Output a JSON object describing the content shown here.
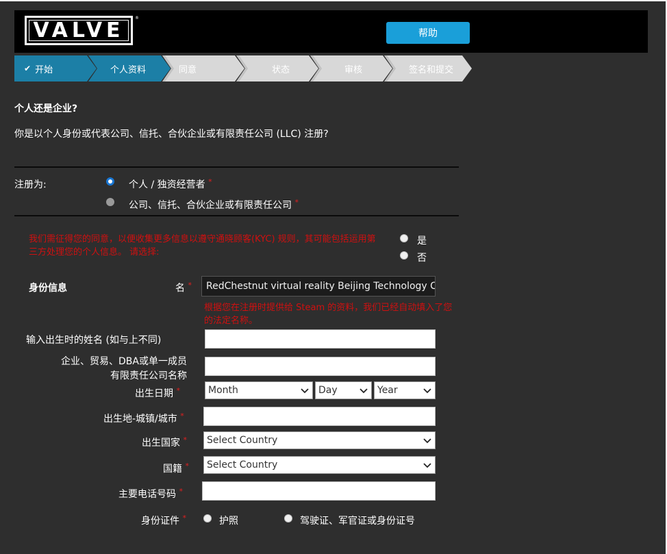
{
  "header": {
    "logo_text": "VALVE",
    "logo_tm": "®",
    "help_label": "帮助",
    "help_color": "#1a9fd9"
  },
  "steps": [
    {
      "label": "开始",
      "state": "done",
      "check": "✔"
    },
    {
      "label": "个人资料",
      "state": "active"
    },
    {
      "label": "同意",
      "state": "pending"
    },
    {
      "label": "状态",
      "state": "pending"
    },
    {
      "label": "审核",
      "state": "pending"
    },
    {
      "label": "签名和提交",
      "state": "pending"
    }
  ],
  "entity": {
    "heading": "个人还是企业?",
    "question": "你是以个人身份或代表公司、信托、合伙企业或有限责任公司 (LLC) 注册?",
    "register_as_label": "注册为:",
    "option_individual": "个人 / 独资经营者",
    "option_company": "公司、信托、合伙企业或有限责任公司",
    "required_mark": "*"
  },
  "kyc": {
    "text": "我们需征得您的同意，以便收集更多信息以遵守通晓顾客(KYC) 规则，其可能包括运用第三方处理您的个人信息。 请选择:",
    "yes": "是",
    "no": "否"
  },
  "identity": {
    "section_label": "身份信息",
    "name_label": "名",
    "name_value": "RedChestnut virtual reality Beijing Technology Co.",
    "autofill_note": "根据您在注册时提供给 Steam 的资料，我们已经自动填入了您的法定名称。",
    "birth_name_label": "输入出生时的姓名 (如与上不同)",
    "business_name_label_line1": "企业、贸易、DBA或单一成员",
    "business_name_label_line2": "有限责任公司名称",
    "dob_label": "出生日期",
    "month": "Month",
    "day": "Day",
    "year": "Year",
    "birthplace_label": "出生地-城镇/城市",
    "birth_country_label": "出生国家",
    "birth_country_value": "Select Country",
    "nationality_label": "国籍",
    "nationality_value": "Select Country",
    "phone_label": "主要电话号码",
    "id_label": "身份证件",
    "id_passport": "护照",
    "id_other": "驾驶证、军官证或身份证号"
  },
  "colors": {
    "background": "#2e2e2e",
    "step_active": "#1c7fa6",
    "step_pending": "#d8d8d8",
    "required": "#e02020",
    "warning_text": "#d01010"
  }
}
